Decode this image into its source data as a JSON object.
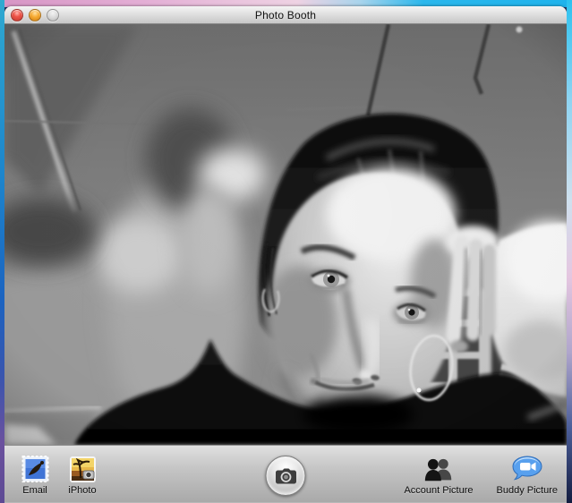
{
  "window": {
    "title": "Photo Booth"
  },
  "titlebar": {
    "traffic_lights": [
      {
        "name": "close",
        "color": "#ee5448"
      },
      {
        "name": "minimize",
        "color": "#f6a930"
      },
      {
        "name": "zoom",
        "color": "#d9d9d9",
        "state": "inactive"
      }
    ]
  },
  "viewfinder": {
    "description": "Black-and-white webcam live preview: woman in a dark turtleneck with a large hoop earring rests her head on her hand; a motion-blurred figure walks past in the background; white paneled door and ceiling pipes behind her."
  },
  "toolbar": {
    "left_buttons": [
      {
        "label": "Email",
        "icon": "mail-stamp-icon"
      },
      {
        "label": "iPhoto",
        "icon": "iphoto-icon"
      }
    ],
    "shutter": {
      "icon": "camera-icon"
    },
    "right_buttons": [
      {
        "label": "Account Picture",
        "icon": "two-people-icon"
      },
      {
        "label": "Buddy Picture",
        "icon": "chat-bubble-video-icon"
      }
    ]
  },
  "colors": {
    "titlebar_top": "#f5f5f5",
    "titlebar_bottom": "#c7c7c7",
    "toolbar_top": "#e0e0e0",
    "toolbar_bottom": "#a9a9a9",
    "buddy_bubble_blue": "#58a0ee",
    "mail_stamp_blue": "#3f74d6",
    "desktop_pink": "#e3aed5",
    "desktop_cyan": "#25b5ea",
    "desktop_purple": "#5d4a94"
  }
}
